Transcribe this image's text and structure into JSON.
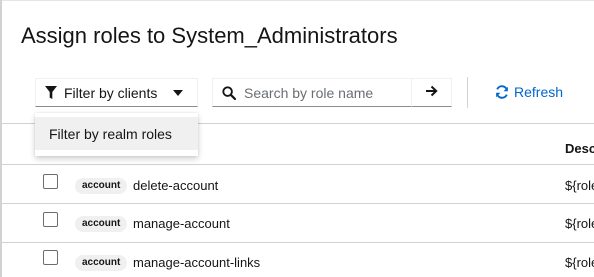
{
  "modal": {
    "title": "Assign roles to System_Administrators"
  },
  "toolbar": {
    "filter_label": "Filter by clients",
    "search_placeholder": "Search by role name",
    "search_value": "",
    "refresh_label": "Refresh"
  },
  "filter_menu": {
    "items": [
      {
        "label": "Filter by realm roles"
      }
    ]
  },
  "table": {
    "columns": {
      "description": "Desc"
    },
    "rows": [
      {
        "client": "account",
        "role": "delete-account",
        "description": "${role"
      },
      {
        "client": "account",
        "role": "manage-account",
        "description": "${role"
      },
      {
        "client": "account",
        "role": "manage-account-links",
        "description": "${role"
      }
    ]
  },
  "colors": {
    "link": "#0066cc",
    "text": "#151515",
    "border": "#d2d2d2",
    "badge_bg": "#f0f0f0"
  },
  "icons": {
    "filter": "filter-icon",
    "search": "search-icon",
    "go": "arrow-right-icon",
    "refresh": "sync-icon",
    "caret": "caret-down-icon"
  }
}
